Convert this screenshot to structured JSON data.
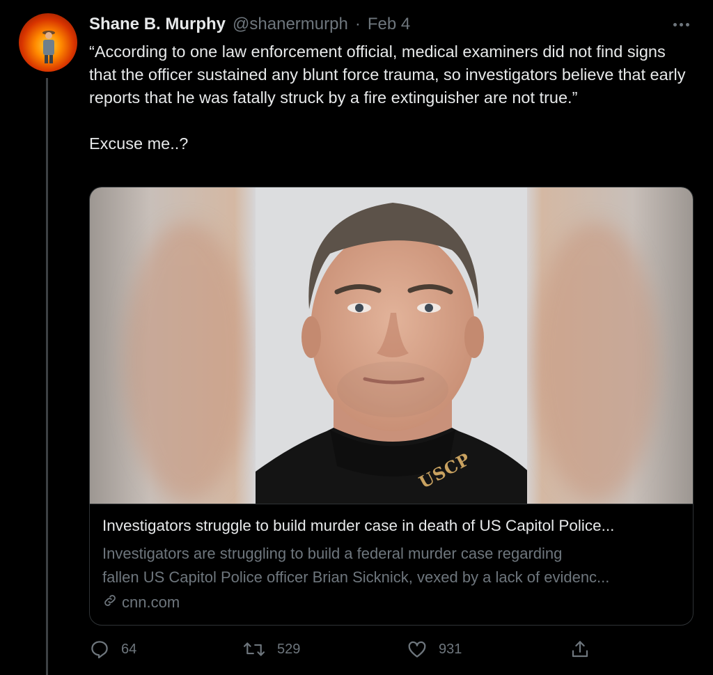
{
  "tweet": {
    "author_name": "Shane B. Murphy",
    "author_handle": "@shanermurph",
    "separator": "·",
    "date": "Feb 4",
    "text_paragraph_1": "“According to one law enforcement official, medical examiners did not find signs that the officer sustained any blunt force trauma, so investigators believe that early reports that he was fatally struck by a fire extinguisher are not true.”",
    "text_paragraph_2": "Excuse me..?"
  },
  "card": {
    "title": "Investigators struggle to build murder case in death of US Capitol Police...",
    "description_line_1": "Investigators are struggling to build a federal murder case regarding",
    "description_line_2": "fallen US Capitol Police officer Brian Sicknick, vexed by a lack of evidenc...",
    "domain": "cnn.com",
    "image_shirt_text": "USCP"
  },
  "actions": {
    "reply_count": "64",
    "retweet_count": "529",
    "like_count": "931"
  },
  "icons": {
    "more": "more-icon",
    "reply": "reply-icon",
    "retweet": "retweet-icon",
    "like": "heart-icon",
    "share": "share-icon",
    "link": "link-icon"
  },
  "colors": {
    "background": "#000000",
    "primary_text": "#e7e9ea",
    "secondary_text": "#6e767d",
    "border": "#2f3336"
  }
}
